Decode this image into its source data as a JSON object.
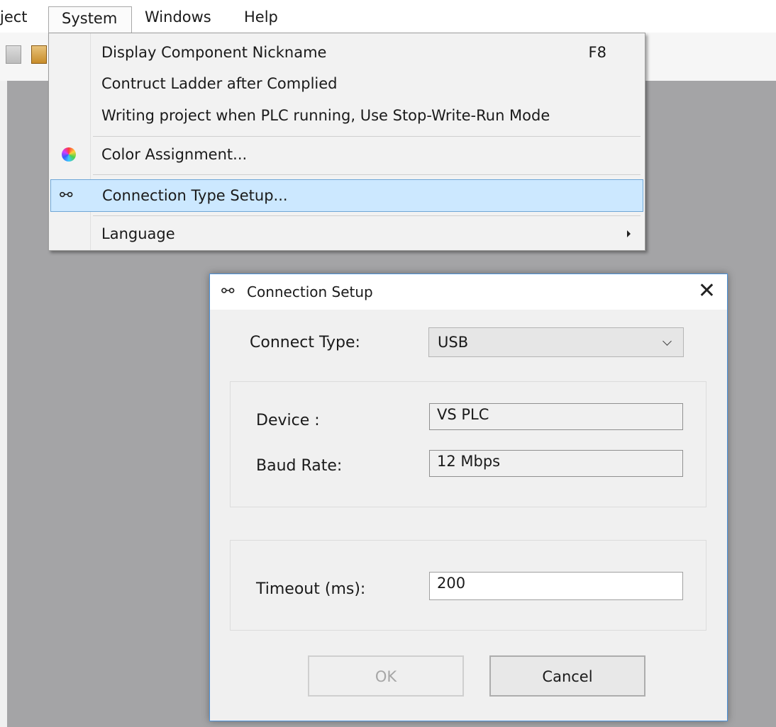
{
  "menubar": {
    "items": [
      "ject",
      "System",
      "Windows",
      "Help"
    ]
  },
  "system_menu": {
    "items": [
      {
        "label": "Display Component Nickname",
        "shortcut": "F8"
      },
      {
        "label": "Contruct Ladder after Complied"
      },
      {
        "label": "Writing project when PLC running, Use Stop-Write-Run Mode"
      },
      {
        "label": "Color Assignment...",
        "icon": "color-wheel-icon"
      },
      {
        "label": "Connection Type Setup...",
        "icon": "connection-setup-icon",
        "highlighted": true
      },
      {
        "label": "Language",
        "submenu": true
      }
    ]
  },
  "dialog": {
    "title": "Connection Setup",
    "connect_type_label": "Connect Type:",
    "connect_type_value": "USB",
    "device_label": "Device :",
    "device_value": "VS PLC",
    "baud_label": "Baud Rate:",
    "baud_value": "12 Mbps",
    "timeout_label": "Timeout (ms):",
    "timeout_value": "200",
    "ok_label": "OK",
    "cancel_label": "Cancel"
  },
  "colors": {
    "highlight": "#cce8ff",
    "highlight_border": "#6fa7d6",
    "dialog_border": "#4a90d9",
    "workspace": "#a4a4a6"
  }
}
